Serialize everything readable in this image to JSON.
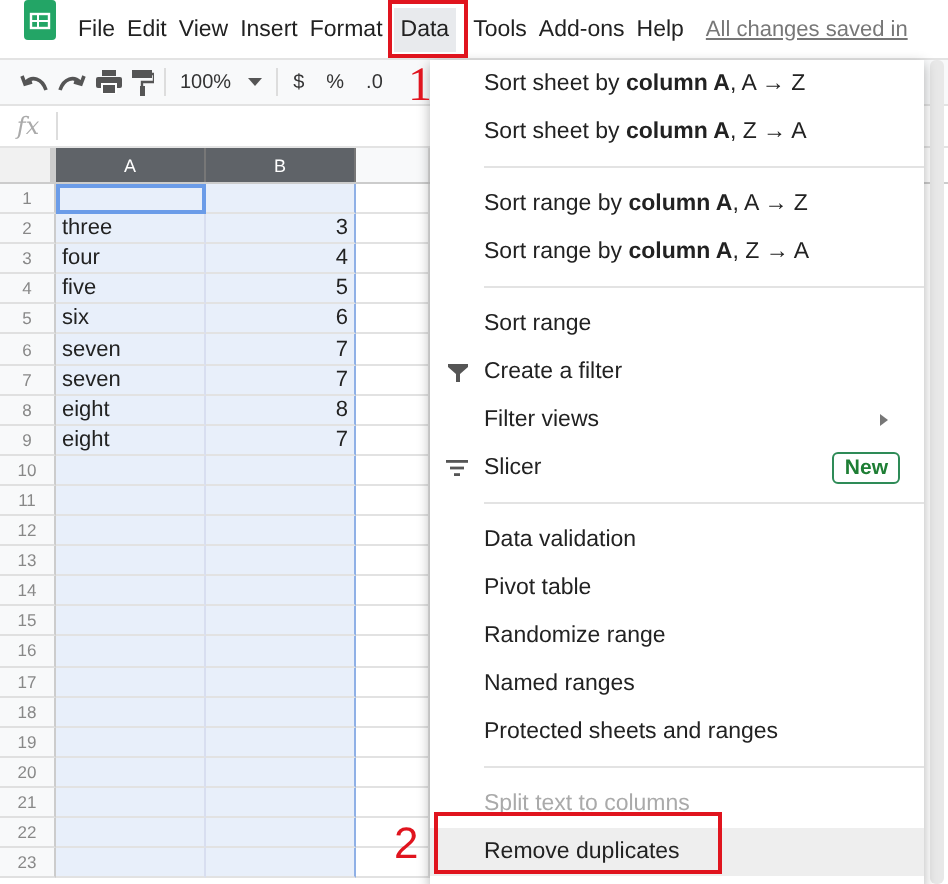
{
  "menubar": {
    "items": [
      {
        "label": "File",
        "selected": false
      },
      {
        "label": "Edit",
        "selected": false
      },
      {
        "label": "View",
        "selected": false
      },
      {
        "label": "Insert",
        "selected": false
      },
      {
        "label": "Format",
        "selected": false
      },
      {
        "label": "Data",
        "selected": true
      },
      {
        "label": "Tools",
        "selected": false
      },
      {
        "label": "Add-ons",
        "selected": false
      },
      {
        "label": "Help",
        "selected": false
      }
    ],
    "save_status": "All changes saved in"
  },
  "toolbar": {
    "zoom": "100%",
    "currency": "$",
    "percent": "%",
    "decimal": ".0"
  },
  "formula_bar": {
    "label": "fx"
  },
  "sheet": {
    "columns": [
      {
        "label": "A",
        "selected": true
      },
      {
        "label": "B",
        "selected": true
      },
      {
        "selected": false
      }
    ],
    "rows": [
      {
        "number": "1",
        "cells": [
          {
            "active": true
          },
          {
            "active": false
          }
        ]
      },
      {
        "number": "2",
        "cells": [
          {
            "text": "three",
            "active": false
          },
          {
            "text": "3",
            "active": false
          }
        ]
      },
      {
        "number": "3",
        "cells": [
          {
            "text": "four",
            "active": false
          },
          {
            "text": "4",
            "active": false
          }
        ]
      },
      {
        "number": "4",
        "cells": [
          {
            "text": "five",
            "active": false
          },
          {
            "text": "5",
            "active": false
          }
        ]
      },
      {
        "number": "5",
        "cells": [
          {
            "text": "six",
            "active": false
          },
          {
            "text": "6",
            "active": false
          }
        ]
      },
      {
        "number": "6",
        "cells": [
          {
            "text": "seven",
            "active": false
          },
          {
            "text": "7",
            "active": false
          }
        ]
      },
      {
        "number": "7",
        "cells": [
          {
            "text": "seven",
            "active": false
          },
          {
            "text": "7",
            "active": false
          }
        ]
      },
      {
        "number": "8",
        "cells": [
          {
            "text": "eight",
            "active": false
          },
          {
            "text": "8",
            "active": false
          }
        ]
      },
      {
        "number": "9",
        "cells": [
          {
            "text": "eight",
            "active": false
          },
          {
            "text": "7",
            "active": false
          }
        ]
      },
      {
        "number": "10"
      },
      {
        "number": "11"
      },
      {
        "number": "12"
      },
      {
        "number": "13"
      },
      {
        "number": "14"
      },
      {
        "number": "15"
      },
      {
        "number": "16"
      },
      {
        "number": "17"
      },
      {
        "number": "18"
      },
      {
        "number": "19"
      },
      {
        "number": "20"
      },
      {
        "number": "21"
      },
      {
        "number": "22"
      },
      {
        "number": "23"
      }
    ]
  },
  "data_menu": {
    "groups": [
      [
        {
          "kind": "text",
          "label": "Sort sheet by **column A**, A → Z",
          "disabled": false,
          "selected": false
        },
        {
          "kind": "text",
          "label": "Sort sheet by **column A**, Z → A",
          "disabled": false,
          "selected": false
        }
      ],
      [
        {
          "kind": "text",
          "label": "Sort range by **column A**, A → Z",
          "disabled": false,
          "selected": false
        },
        {
          "kind": "text",
          "label": "Sort range by **column A**, Z → A",
          "disabled": false,
          "selected": false
        }
      ],
      [
        {
          "kind": "text",
          "label": "Sort range",
          "disabled": false,
          "selected": false
        },
        {
          "kind": "filter",
          "label": "Create a filter",
          "disabled": false,
          "selected": false
        },
        {
          "kind": "text",
          "label": "Filter views",
          "submenu": true,
          "disabled": false,
          "selected": false
        },
        {
          "kind": "slicer",
          "label": "Slicer",
          "badge": "New",
          "disabled": false,
          "selected": false
        }
      ],
      [
        {
          "kind": "text",
          "label": "Data validation",
          "disabled": false,
          "selected": false
        },
        {
          "kind": "text",
          "label": "Pivot table",
          "disabled": false,
          "selected": false
        },
        {
          "kind": "text",
          "label": "Randomize range",
          "disabled": false,
          "selected": false
        },
        {
          "kind": "text",
          "label": "Named ranges",
          "disabled": false,
          "selected": false
        },
        {
          "kind": "text",
          "label": "Protected sheets and ranges",
          "disabled": false,
          "selected": false
        }
      ],
      [
        {
          "kind": "text",
          "label": "Split text to columns",
          "disabled": true,
          "selected": false
        },
        {
          "kind": "text",
          "label": "Remove duplicates",
          "disabled": false,
          "selected": true
        }
      ]
    ]
  },
  "annotations": [
    {
      "label": "1"
    },
    {
      "label": "2"
    }
  ]
}
